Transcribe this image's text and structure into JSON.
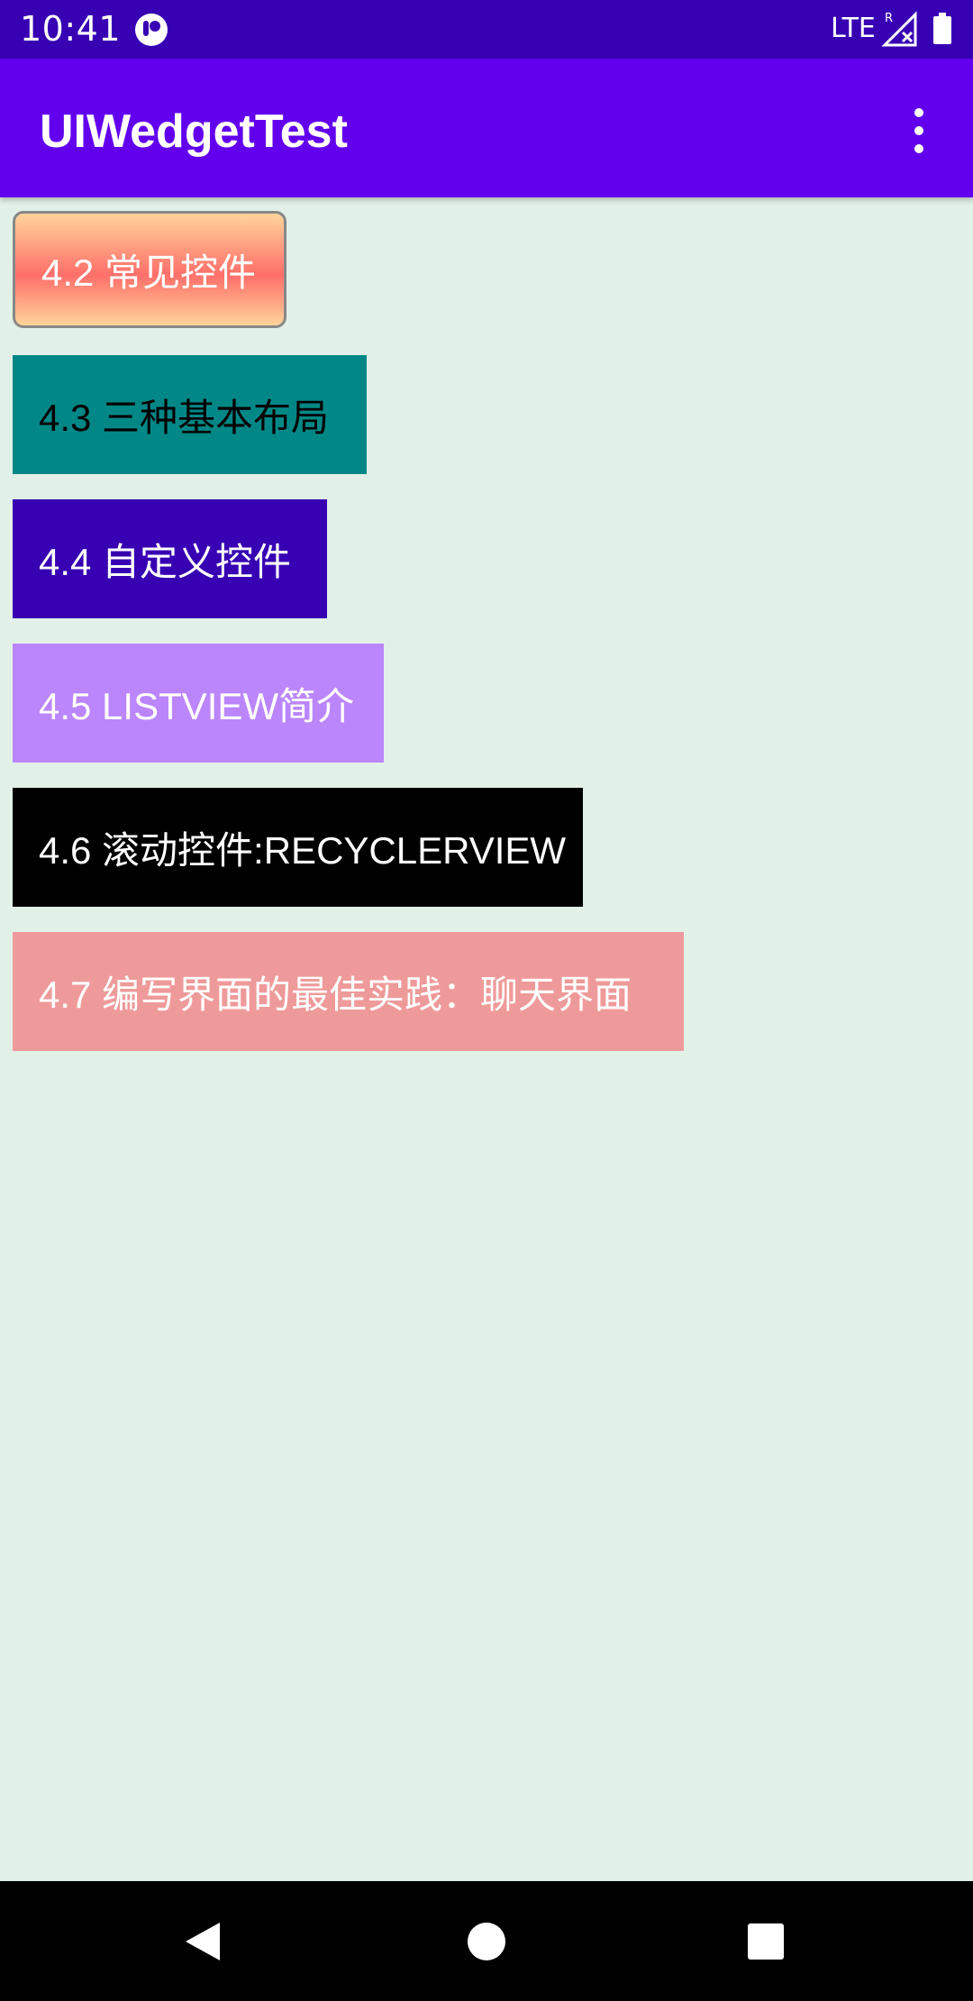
{
  "status_bar": {
    "time": "10:41",
    "network": "LTE",
    "background_color": "#3700b3",
    "icons": [
      "app-notification-icon",
      "signal-icon",
      "battery-icon"
    ]
  },
  "app_bar": {
    "title": "UIWedgetTest",
    "background_color": "#6200ee",
    "menu_icon": "more-vert-icon"
  },
  "buttons": [
    {
      "label": "4.2 常见控件",
      "background": "gradient #ffd49a → #ff6f6a",
      "text_color": "#ffffff"
    },
    {
      "label": "4.3 三种基本布局",
      "background": "#018786",
      "text_color": "#000000"
    },
    {
      "label": "4.4 自定义控件",
      "background": "#3700b3",
      "text_color": "#ffffff"
    },
    {
      "label": "4.5 LISTVIEW简介",
      "background": "#bb86fc",
      "text_color": "#ffffff"
    },
    {
      "label": "4.6 滚动控件:RECYCLERVIEW",
      "background": "#000000",
      "text_color": "#ffffff"
    },
    {
      "label": "4.7 编写界面的最佳实践：聊天界面",
      "background": "#ef9a9a",
      "text_color": "#ffffff"
    }
  ],
  "content_background": "#e2f1e8",
  "nav_bar": {
    "icons": [
      "back-icon",
      "home-icon",
      "recents-icon"
    ]
  }
}
